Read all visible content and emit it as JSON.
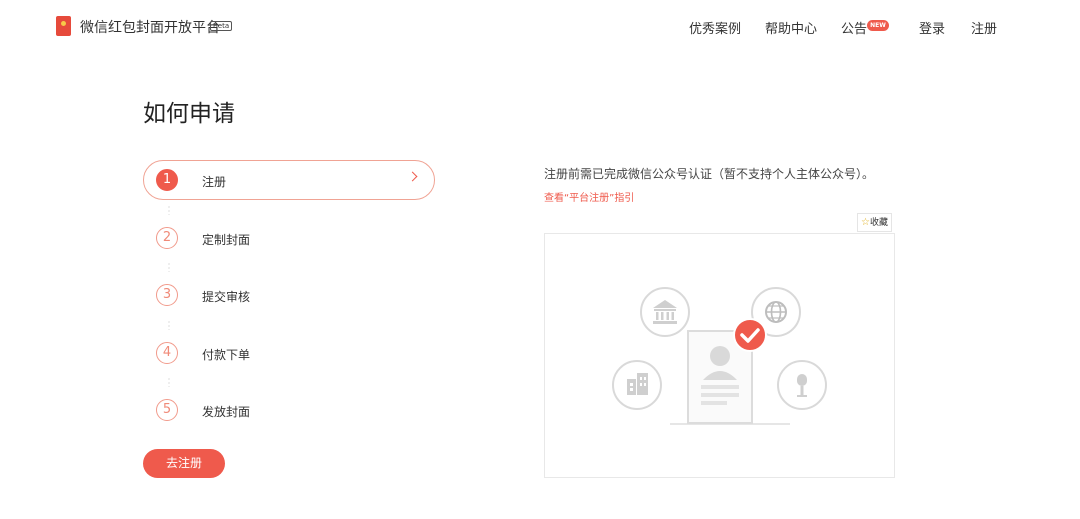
{
  "header": {
    "brand": "微信红包封面开放平台",
    "beta": "Beta",
    "nav": {
      "cases": "优秀案例",
      "help": "帮助中心",
      "notice": "公告",
      "notice_badge": "NEW",
      "login": "登录",
      "register": "注册"
    }
  },
  "page": {
    "title": "如何申请"
  },
  "steps": [
    {
      "num": "1",
      "label": "注册"
    },
    {
      "num": "2",
      "label": "定制封面"
    },
    {
      "num": "3",
      "label": "提交审核"
    },
    {
      "num": "4",
      "label": "付款下单"
    },
    {
      "num": "5",
      "label": "发放封面"
    }
  ],
  "action": {
    "register_button": "去注册"
  },
  "detail": {
    "description": "注册前需已完成微信公众号认证（暂不支持个人主体公众号）。",
    "guide_link": "查看“平台注册”指引",
    "favorite": "收藏"
  },
  "colors": {
    "accent": "#ef5a4c",
    "accent_light": "#f0a394"
  }
}
